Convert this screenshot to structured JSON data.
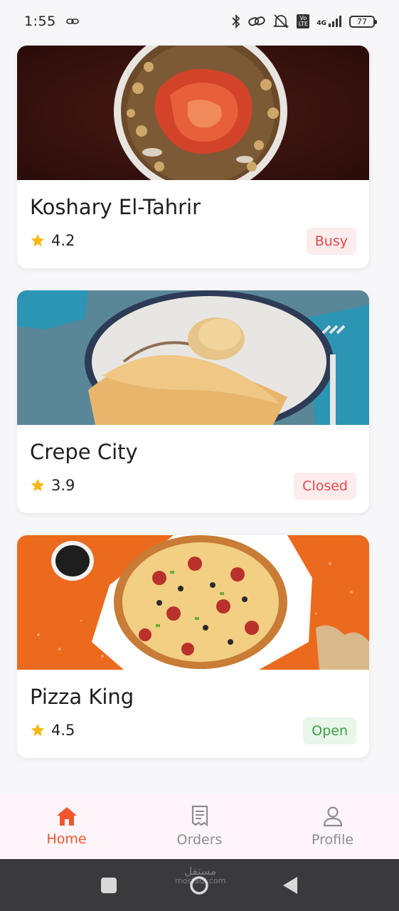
{
  "status_bar": {
    "time": "1:55",
    "network": "4G",
    "volte": "Vo LTE",
    "battery": "77"
  },
  "restaurants": [
    {
      "name": "Koshary El-Tahrir",
      "rating": "4.2",
      "status": "Busy",
      "status_color": "#e24a4a"
    },
    {
      "name": "Crepe City",
      "rating": "3.9",
      "status": "Closed",
      "status_color": "#e24a4a"
    },
    {
      "name": "Pizza King",
      "rating": "4.5",
      "status": "Open",
      "status_color": "#3aa044"
    }
  ],
  "bottom_nav": {
    "items": [
      {
        "label": "Home",
        "icon": "home-icon",
        "active": true
      },
      {
        "label": "Orders",
        "icon": "receipt-icon",
        "active": false
      },
      {
        "label": "Profile",
        "icon": "person-icon",
        "active": false
      }
    ]
  },
  "colors": {
    "accent": "#f0562c",
    "star": "#f5b915",
    "open": "#3aa044",
    "closed": "#e24a4a"
  },
  "watermark": {
    "line1": "مستقل",
    "line2": "mostaql.com"
  }
}
